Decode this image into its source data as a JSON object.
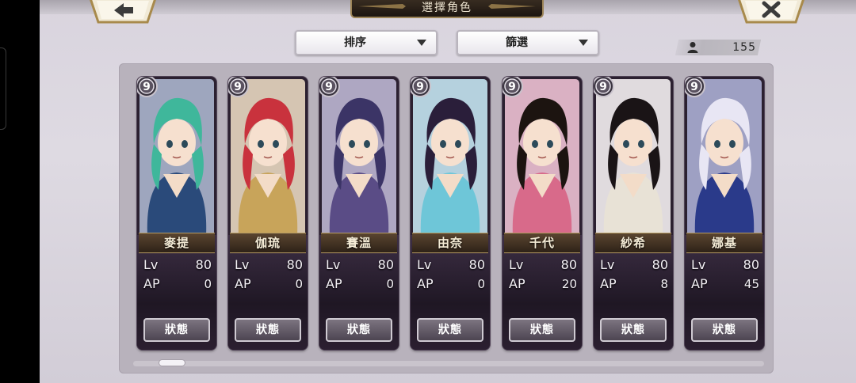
{
  "header": {
    "title": "選擇角色",
    "back_icon": "arrow-left-icon",
    "close_icon": "close-x-icon"
  },
  "filters": {
    "sort_label": "排序",
    "filter_label": "篩選"
  },
  "roster": {
    "count": "155",
    "icon": "person-icon"
  },
  "labels": {
    "lv": "Lv",
    "ap": "AP",
    "status": "狀態"
  },
  "characters": [
    {
      "name": "麥提",
      "rank": "9",
      "lv": "80",
      "ap": "0",
      "hair": "#3fb79b",
      "accent": "#2a4a7a"
    },
    {
      "name": "伽琉",
      "rank": "9",
      "lv": "80",
      "ap": "0",
      "hair": "#c9323d",
      "accent": "#c8a45a"
    },
    {
      "name": "賽溫",
      "rank": "9",
      "lv": "80",
      "ap": "0",
      "hair": "#3b3466",
      "accent": "#5a4c86"
    },
    {
      "name": "由奈",
      "rank": "9",
      "lv": "80",
      "ap": "0",
      "hair": "#2a1e3a",
      "accent": "#6ec6d8"
    },
    {
      "name": "千代",
      "rank": "9",
      "lv": "80",
      "ap": "20",
      "hair": "#1c1410",
      "accent": "#d86a8a"
    },
    {
      "name": "紗希",
      "rank": "9",
      "lv": "80",
      "ap": "8",
      "hair": "#1a1416",
      "accent": "#e8e2d6"
    },
    {
      "name": "娜基",
      "rank": "9",
      "lv": "80",
      "ap": "45",
      "hair": "#e8e6f4",
      "accent": "#2a3a8a"
    }
  ],
  "colors": {
    "panel": "#b8b2bc",
    "card": "#2b2030",
    "gold": "#b59b63"
  }
}
